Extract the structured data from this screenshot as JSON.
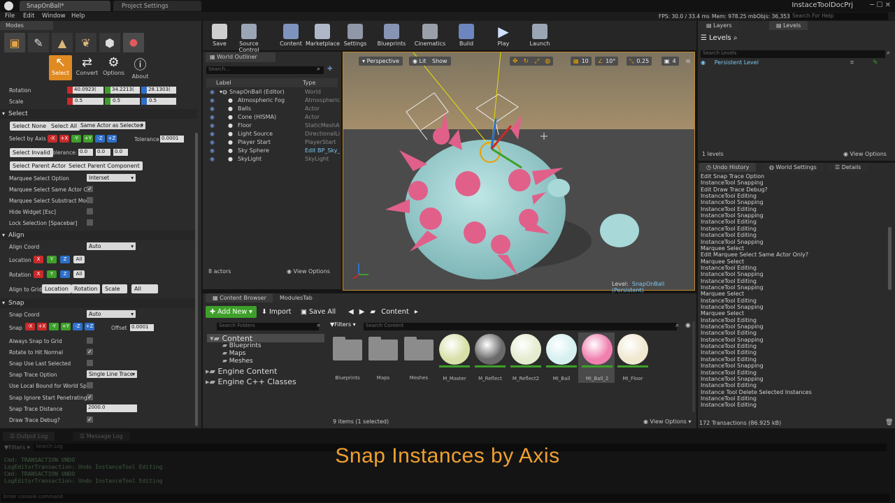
{
  "titlebar": {
    "app_tab": "SnapOnBall*",
    "settings_tab": "Project Settings",
    "project": "InstaceToolDocPrj",
    "search": "Search For Help"
  },
  "menu": [
    "File",
    "Edit",
    "Window",
    "Help"
  ],
  "stats": {
    "fps": "FPS: 30.0 / 33.4 ms",
    "mem": "Mem: 978.25 mb",
    "objs": "Objs: 36,353"
  },
  "modes": {
    "title": "Modes",
    "tools": [
      "Select",
      "Convert",
      "Options",
      "About"
    ]
  },
  "transform": {
    "rotation_label": "Rotation",
    "rotation": [
      "40.0923(",
      "34.2213(",
      "28.1303("
    ],
    "scale_label": "Scale",
    "scale": [
      "0.5",
      "0.5",
      "0.5"
    ]
  },
  "select": {
    "header": "Select",
    "select_none": "Select None",
    "select_all": "Select All",
    "same_actor": "Same Actor as Selected",
    "by_axis": "Select by Axis",
    "tolerance": "Tolerance",
    "tol_val": "0.0001",
    "select_invalid": "Select Invalid",
    "tolerance2": "Tolerance:",
    "tv": [
      "0.0",
      "0.0",
      "0.0"
    ],
    "parent_actor": "Select Parent Actor",
    "parent_component": "Select Parent Component",
    "marquee_opt": "Marquee Select Option",
    "marquee_val": "Interset",
    "marquee_same": "Marquee Select Same Actor Onl",
    "marquee_sub": "Marquee Select Substract Mode",
    "hide_widget": "Hide Widget [Esc]",
    "lock": "Lock Selection [Spacebar]"
  },
  "align": {
    "header": "Align",
    "coord": "Align Coord",
    "coord_val": "Auto",
    "location": "Location",
    "rotation": "Rotation",
    "grid": "Align to Grid",
    "g_loc": "Location",
    "g_rot": "Rotation",
    "g_scale": "Scale",
    "g_all": "All"
  },
  "snap": {
    "header": "Snap",
    "coord": "Snap Coord",
    "coord_val": "Auto",
    "snap": "Snap",
    "offset": "Offset",
    "offset_val": "0.0001",
    "always": "Always Snap to Grid",
    "rotate": "Rotate to Hit Normal",
    "last": "Snap Use Last Selected",
    "trace_opt": "Snap Trace Option",
    "trace_val": "Single Line Trace",
    "local": "Use Local Bound for World Spac",
    "ignore": "Snap Ignore Start Penetrating",
    "distance": "Snap Trace Distance",
    "distance_val": "2000.0",
    "debug": "Draw Trace Debug?"
  },
  "axis_buttons": [
    "-X",
    "+X",
    "-Y",
    "+Y",
    "-Z",
    "+Z"
  ],
  "xyz": [
    "X",
    "Y",
    "Z",
    "All"
  ],
  "toolbar": [
    "Save",
    "Source Control",
    "Content",
    "Marketplace",
    "Settings",
    "Blueprints",
    "Cinematics",
    "Build",
    "Play",
    "Launch"
  ],
  "outliner": {
    "title": "World Outliner",
    "search": "Search...",
    "col_label": "Label",
    "col_type": "Type",
    "rows": [
      [
        "SnapOnBall (Editor)",
        "World"
      ],
      [
        "Atmospheric Fog",
        "AtmosphericF"
      ],
      [
        "Balls",
        "Actor"
      ],
      [
        "Cone (HISMA)",
        "Actor"
      ],
      [
        "Floor",
        "StaticMeshAc"
      ],
      [
        "Light Source",
        "DirectionalLig"
      ],
      [
        "Player Start",
        "PlayerStart"
      ],
      [
        "Sky Sphere",
        "Edit BP_Sky_"
      ],
      [
        "SkyLight",
        "SkyLight"
      ]
    ],
    "count": "8 actors",
    "view": "View Options"
  },
  "viewport": {
    "perspective": "Perspective",
    "lit": "Lit",
    "show": "Show",
    "grid": "10",
    "angle": "10°",
    "scale": "0.25",
    "cam": "4",
    "level_label": "Level:",
    "level": "SnapOnBall (Persistent)"
  },
  "layers": {
    "tab1": "Layers",
    "tab2": "Levels",
    "levels_title": "Levels",
    "search": "Search Levels",
    "item": "Persistent Level",
    "count": "1 levels",
    "view": "View Options"
  },
  "undo": {
    "tab": "Undo History",
    "tab2": "World Settings",
    "tab3": "Details",
    "items": [
      "Edit Snap Trace Option",
      "InstanceTool Snapping",
      "Edit Draw Trace Debug?",
      "InstanceTool Editing",
      "InstanceTool Snapping",
      "InstanceTool Editing",
      "InstanceTool Snapping",
      "InstanceTool Editing",
      "InstanceTool Editing",
      "InstanceTool Editing",
      "InstanceTool Snapping",
      "Marquee Select",
      "Edit Marquee Select Same Actor Only?",
      "Marquee Select",
      "InstanceTool Editing",
      "InstanceTool Snapping",
      "InstanceTool Editing",
      "InstanceTool Snapping",
      "Marquee Select",
      "InstanceTool Editing",
      "InstanceTool Snapping",
      "Marquee Select",
      "InstanceTool Editing",
      "InstanceTool Snapping",
      "InstanceTool Editing",
      "InstanceTool Snapping",
      "InstanceTool Editing",
      "InstanceTool Editing",
      "InstanceTool Editing",
      "InstanceTool Snapping",
      "InstanceTool Editing",
      "InstanceTool Snapping",
      "InstanceTool Editing",
      "Instance Tool Delete Selected Instances",
      "InstanceTool Editing",
      "InstanceTool Editing"
    ],
    "footer": "172 Transactions (86.925 kB)"
  },
  "content": {
    "tab1": "Content Browser",
    "tab2": "ModulesTab",
    "add_new": "Add New",
    "import": "Import",
    "save_all": "Save All",
    "path": "Content",
    "search_folders": "Search Folders",
    "filters": "Filters",
    "search_content": "Search Content",
    "tree": [
      "Content",
      "Blueprints",
      "Maps",
      "Meshes",
      "Engine Content",
      "Engine C++ Classes"
    ],
    "assets": [
      "Blueprints",
      "Maps",
      "Meshes",
      "M_Master",
      "M_Reflect",
      "M_Reflect2",
      "MI_Ball",
      "MI_Ball_2",
      "MI_Floor"
    ],
    "status": "9 items (1 selected)",
    "view": "View Options"
  },
  "output": {
    "tab1": "Output Log",
    "tab2": "Message Log",
    "filters": "Filters",
    "search": "Search Log",
    "lines": [
      "Cmd: TRANSACTION UNDO",
      "LogEditorTransaction: Undo InstanceTool Editing",
      "Cmd: TRANSACTION UNDO",
      "LogEditorTransaction: Undo InstanceTool Editing"
    ],
    "cmd": "Enter console command"
  },
  "caption": "Snap Instances by Axis"
}
